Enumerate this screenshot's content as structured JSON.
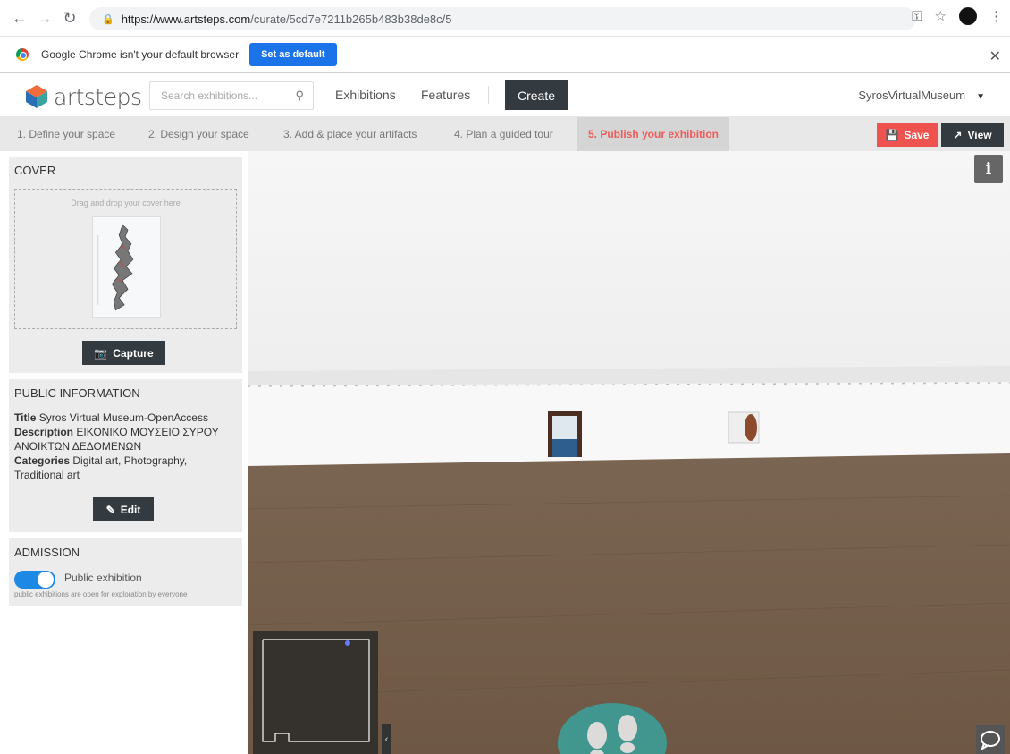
{
  "browser": {
    "url_host": "https://www.artsteps.com",
    "url_path": "/curate/5cd7e7211b265b483b38de8c/5",
    "infobar_message": "Google Chrome isn't your default browser",
    "set_default_label": "Set as default"
  },
  "header": {
    "logo_text": "artsteps",
    "search_placeholder": "Search exhibitions...",
    "nav": [
      "Exhibitions",
      "Features"
    ],
    "create_label": "Create",
    "user_name": "SyrosVirtualMuseum"
  },
  "steps": [
    "1. Define your space",
    "2. Design your space",
    "3. Add & place your artifacts",
    "4. Plan a guided tour",
    "5. Publish your exhibition"
  ],
  "active_step_index": 4,
  "actions": {
    "save_label": "Save",
    "view_label": "View"
  },
  "cover": {
    "title": "COVER",
    "dropzone_hint": "Drag and drop your cover here",
    "capture_label": "Capture"
  },
  "public_info": {
    "title": "PUBLIC INFORMATION",
    "title_label": "Title",
    "title_value": "Syros Virtual Museum-OpenAccess",
    "description_label": "Description",
    "description_value": "ΕΙΚΟΝΙΚΟ ΜΟΥΣΕΙΟ ΣΥΡΟΥ ΑΝΟΙΚΤΩΝ ΔΕΔΟΜΕΝΩΝ",
    "categories_label": "Categories",
    "categories_value": "Digital art, Photography, Traditional art",
    "edit_label": "Edit"
  },
  "admission": {
    "title": "ADMISSION",
    "toggle_on": true,
    "toggle_label": "Public exhibition",
    "note": "public exhibitions are open for exploration by everyone"
  },
  "colors": {
    "accent_red": "#ef5350",
    "dark_button": "#333a40",
    "toggle_blue": "#1e88e5",
    "walk_teal": "#3d9e97"
  },
  "icons": {
    "info": "info-icon",
    "chat": "chat-bubble-icon",
    "walk": "footsteps-icon",
    "camera": "camera-icon",
    "save": "floppy-icon",
    "view": "external-link-icon",
    "edit": "edit-icon"
  }
}
